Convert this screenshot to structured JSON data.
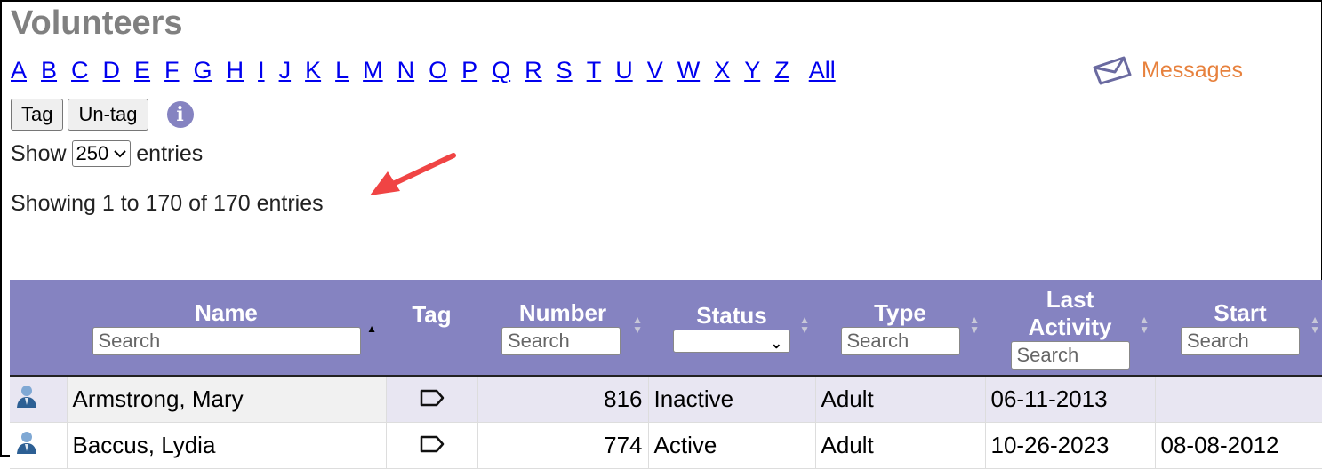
{
  "page": {
    "title": "Volunteers"
  },
  "alphabet": [
    "A",
    "B",
    "C",
    "D",
    "E",
    "F",
    "G",
    "H",
    "I",
    "J",
    "K",
    "L",
    "M",
    "N",
    "O",
    "P",
    "Q",
    "R",
    "S",
    "T",
    "U",
    "V",
    "W",
    "X",
    "Y",
    "Z"
  ],
  "alphabet_all": "All",
  "messages": {
    "label": "Messages",
    "icon": "envelope-icon"
  },
  "toolbar": {
    "tag_label": "Tag",
    "untag_label": "Un-tag",
    "info_icon": "i"
  },
  "length": {
    "prefix": "Show",
    "value": "250",
    "suffix": "entries"
  },
  "info_text": "Showing 1 to 170 of 170 entries",
  "colors": {
    "header_bg": "#8583c1",
    "link": "#0000ee",
    "messages": "#e7813d",
    "arrow": "#f04444"
  },
  "table": {
    "columns": [
      {
        "label": "",
        "filter": ""
      },
      {
        "label": "Name",
        "filter": "Search"
      },
      {
        "label": "Tag"
      },
      {
        "label": "Number",
        "filter": "Search"
      },
      {
        "label": "Status",
        "filter_value": ""
      },
      {
        "label": "Type",
        "filter": "Search"
      },
      {
        "label": "Last Activity",
        "filter": "Search"
      },
      {
        "label": "Start",
        "filter": "Search"
      }
    ],
    "rows": [
      {
        "name": "Armstrong, Mary",
        "number": "816",
        "status": "Inactive",
        "type": "Adult",
        "last_activity": "06-11-2013",
        "start": ""
      },
      {
        "name": "Baccus, Lydia",
        "number": "774",
        "status": "Active",
        "type": "Adult",
        "last_activity": "10-26-2023",
        "start": "08-08-2012"
      }
    ]
  }
}
